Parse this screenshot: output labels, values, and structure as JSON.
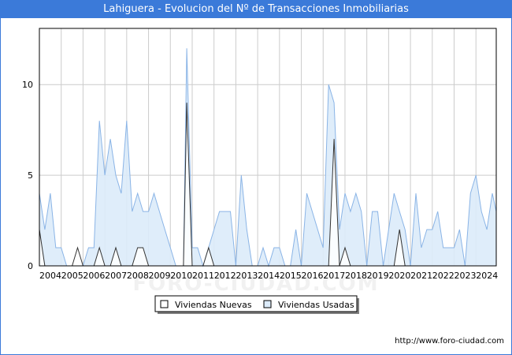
{
  "title": "Lahiguera - Evolucion del Nº de Transacciones Inmobiliarias",
  "footer": "http://www.foro-ciudad.com",
  "watermark": "FORO-CIUDAD.COM",
  "colors": {
    "title_bg": "#3b7ad9",
    "nuevas_fill": "#ffffff",
    "nuevas_line": "#333333",
    "usadas_fill": "#dcebfa",
    "usadas_line": "#8ab4e6",
    "grid": "#cccccc"
  },
  "chart_data": {
    "type": "area",
    "x_tick_labels": [
      "2004",
      "2005",
      "2006",
      "2007",
      "2008",
      "2009",
      "2010",
      "2011",
      "2012",
      "2013",
      "2014",
      "2015",
      "2016",
      "2017",
      "2018",
      "2019",
      "2020",
      "2021",
      "2022",
      "2023",
      "2024"
    ],
    "x_start": 2004,
    "x_end": 2024.93,
    "y_ticks": [
      0,
      5,
      10
    ],
    "ylim": [
      0,
      13.1
    ],
    "grid": true,
    "legend_position": "bottom-center",
    "series": [
      {
        "name": "Viviendas Nuevas",
        "x": [
          2004.0,
          2004.25,
          2004.5,
          2004.75,
          2005.0,
          2005.25,
          2005.5,
          2005.75,
          2006.0,
          2006.25,
          2006.5,
          2006.75,
          2007.0,
          2007.25,
          2007.5,
          2007.75,
          2008.0,
          2008.25,
          2008.5,
          2008.75,
          2009.0,
          2009.25,
          2009.5,
          2009.75,
          2010.0,
          2010.25,
          2010.5,
          2010.6,
          2010.75,
          2011.0,
          2011.25,
          2011.5,
          2011.75,
          2012.0,
          2012.25,
          2012.5,
          2012.75,
          2013.0,
          2013.25,
          2013.5,
          2013.75,
          2014.0,
          2014.25,
          2014.5,
          2014.75,
          2015.0,
          2015.25,
          2015.5,
          2015.75,
          2016.0,
          2016.25,
          2016.5,
          2016.75,
          2017.0,
          2017.25,
          2017.5,
          2017.75,
          2018.0,
          2018.25,
          2018.5,
          2018.75,
          2019.0,
          2019.25,
          2019.5,
          2019.75,
          2020.0,
          2020.25,
          2020.5,
          2020.75,
          2021.0,
          2021.25,
          2021.5,
          2021.75,
          2022.0,
          2022.25,
          2022.5,
          2022.75,
          2023.0,
          2023.25,
          2023.5,
          2023.75,
          2024.0,
          2024.25,
          2024.5,
          2024.75,
          2024.93
        ],
        "values": [
          2,
          0,
          0,
          0,
          0,
          0,
          0,
          1,
          0,
          0,
          0,
          1,
          0,
          0,
          1,
          0,
          0,
          0,
          1,
          1,
          0,
          0,
          0,
          0,
          0,
          0,
          0,
          0,
          9,
          0,
          0,
          0,
          1,
          0,
          0,
          0,
          0,
          0,
          0,
          0,
          0,
          0,
          0,
          0,
          0,
          0,
          0,
          0,
          0,
          0,
          0,
          0,
          0,
          0,
          0,
          7,
          0,
          1,
          0,
          0,
          0,
          0,
          0,
          0,
          0,
          0,
          0,
          2,
          0,
          0,
          0,
          0,
          0,
          0,
          0,
          0,
          0,
          0,
          0,
          0,
          0,
          0,
          0,
          0,
          0,
          0
        ]
      },
      {
        "name": "Viviendas Usadas",
        "x": [
          2004.0,
          2004.25,
          2004.5,
          2004.75,
          2005.0,
          2005.25,
          2005.5,
          2005.75,
          2006.0,
          2006.25,
          2006.5,
          2006.75,
          2007.0,
          2007.25,
          2007.5,
          2007.75,
          2008.0,
          2008.25,
          2008.5,
          2008.75,
          2009.0,
          2009.25,
          2009.5,
          2009.75,
          2010.0,
          2010.25,
          2010.5,
          2010.6,
          2010.75,
          2011.0,
          2011.25,
          2011.5,
          2011.75,
          2012.0,
          2012.25,
          2012.5,
          2012.75,
          2013.0,
          2013.25,
          2013.5,
          2013.75,
          2014.0,
          2014.25,
          2014.5,
          2014.75,
          2015.0,
          2015.25,
          2015.5,
          2015.75,
          2016.0,
          2016.25,
          2016.5,
          2016.75,
          2017.0,
          2017.25,
          2017.5,
          2017.75,
          2018.0,
          2018.25,
          2018.5,
          2018.75,
          2019.0,
          2019.25,
          2019.5,
          2019.75,
          2020.0,
          2020.25,
          2020.5,
          2020.75,
          2021.0,
          2021.25,
          2021.5,
          2021.75,
          2022.0,
          2022.25,
          2022.5,
          2022.75,
          2023.0,
          2023.25,
          2023.5,
          2023.75,
          2024.0,
          2024.25,
          2024.5,
          2024.75,
          2024.93
        ],
        "values": [
          4,
          2,
          4,
          1,
          1,
          0,
          0,
          0,
          0,
          1,
          1,
          8,
          5,
          7,
          5,
          4,
          8,
          3,
          4,
          3,
          3,
          4,
          3,
          2,
          1,
          0,
          0,
          0,
          12,
          1,
          1,
          0,
          1,
          2,
          3,
          3,
          3,
          0,
          5,
          2,
          0,
          0,
          1,
          0,
          1,
          1,
          0,
          0,
          2,
          0,
          4,
          3,
          2,
          1,
          10,
          9,
          2,
          4,
          3,
          4,
          3,
          0,
          3,
          3,
          0,
          2,
          4,
          3,
          2,
          0,
          4,
          1,
          2,
          2,
          3,
          1,
          1,
          1,
          2,
          0,
          4,
          5,
          3,
          2,
          4,
          3
        ]
      }
    ]
  }
}
